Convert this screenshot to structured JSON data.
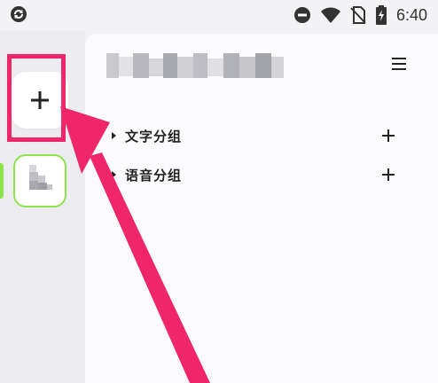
{
  "status_bar": {
    "time": "6:40",
    "icons": [
      "sync-icon",
      "do-not-disturb-icon",
      "wifi-icon",
      "no-sim-icon",
      "battery-charging-icon"
    ]
  },
  "rail": {
    "add_button_icon": "plus-icon",
    "server_avatar_icon": "server-avatar"
  },
  "panel": {
    "title": "",
    "menu_icon": "hamburger-menu-icon",
    "groups": [
      {
        "label": "文字分组",
        "add_icon": "plus-icon"
      },
      {
        "label": "语音分组",
        "add_icon": "plus-icon"
      }
    ]
  },
  "annotation": {
    "highlight_color": "#f0266a",
    "selection_color": "#8ee34a"
  }
}
